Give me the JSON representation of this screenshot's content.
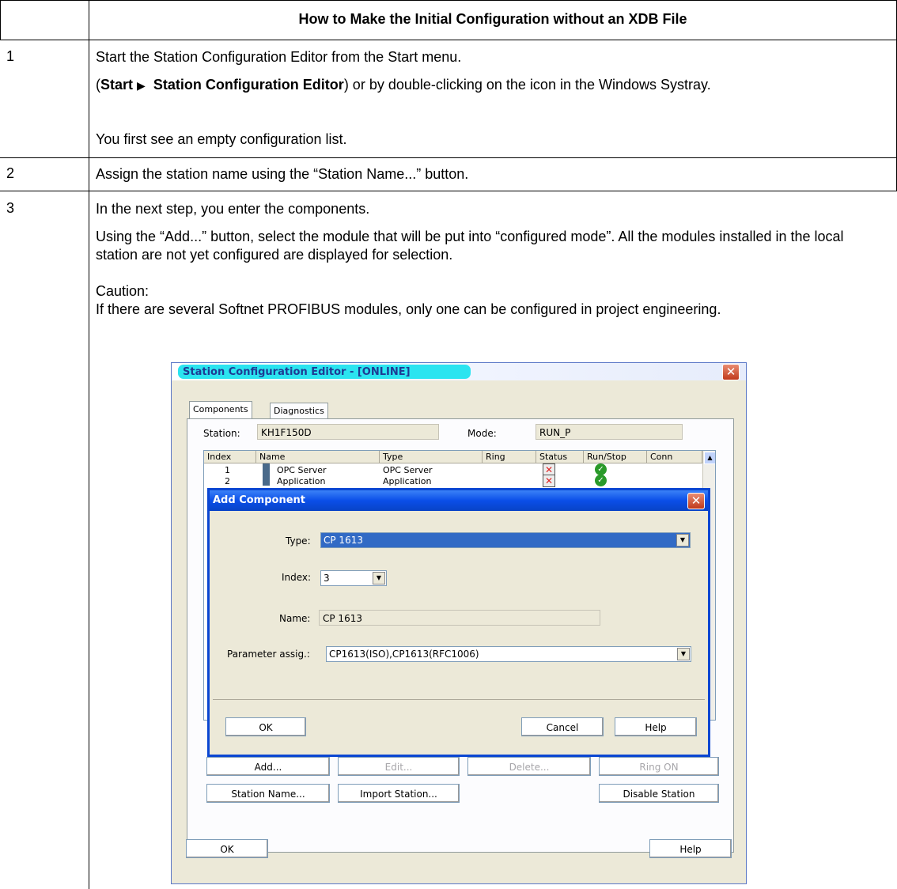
{
  "table": {
    "header": "How to Make the Initial Configuration without an XDB File",
    "rows": [
      {
        "num": "1",
        "line1": "Start the Station Configuration Editor from the Start menu.",
        "line2_open": "(",
        "line2_bold1": "Start",
        "line2_arrow": "▶",
        "line2_bold2": "Station Configuration Editor",
        "line2_rest": ") or by double-clicking on the icon in the Windows Systray.",
        "line3": "You first see an empty configuration list."
      },
      {
        "num": "2",
        "line1": "Assign the station name using the “Station Name...” button."
      },
      {
        "num": "3",
        "line1": "In the next step, you enter the components.",
        "line2": "Using the “Add...” button, select the module that will be put into “configured mode”. All the modules installed in the local station are not yet configured are displayed for selection.",
        "line3": "Caution:",
        "line4": "If there are several Softnet PROFIBUS modules, only one can be configured in project engineering."
      }
    ]
  },
  "editor": {
    "title": "Station Configuration Editor - [ONLINE]",
    "close": "✕",
    "tabs": [
      "Components",
      "Diagnostics"
    ],
    "station_label": "Station:",
    "station_value": "KH1F150D",
    "mode_label": "Mode:",
    "mode_value": "RUN_P",
    "columns": [
      "Index",
      "Name",
      "Type",
      "Ring",
      "Status",
      "Run/Stop",
      "Conn"
    ],
    "rows": [
      {
        "index": "1",
        "name": "OPC Server",
        "type": "OPC Server"
      },
      {
        "index": "2",
        "name": "Application",
        "type": "Application"
      }
    ],
    "buttons": {
      "add": "Add...",
      "edit": "Edit...",
      "delete": "Delete...",
      "ring_on": "Ring ON",
      "station_name": "Station Name...",
      "import_station": "Import Station...",
      "disable_station": "Disable Station",
      "ok": "OK",
      "help": "Help"
    }
  },
  "dialog": {
    "title": "Add Component",
    "close": "✕",
    "type_label": "Type:",
    "type_value": "CP 1613",
    "index_label": "Index:",
    "index_value": "3",
    "name_label": "Name:",
    "name_value": "CP 1613",
    "param_label": "Parameter assig.:",
    "param_value": "CP1613(ISO),CP1613(RFC1006)",
    "ok": "OK",
    "cancel": "Cancel",
    "help": "Help"
  }
}
